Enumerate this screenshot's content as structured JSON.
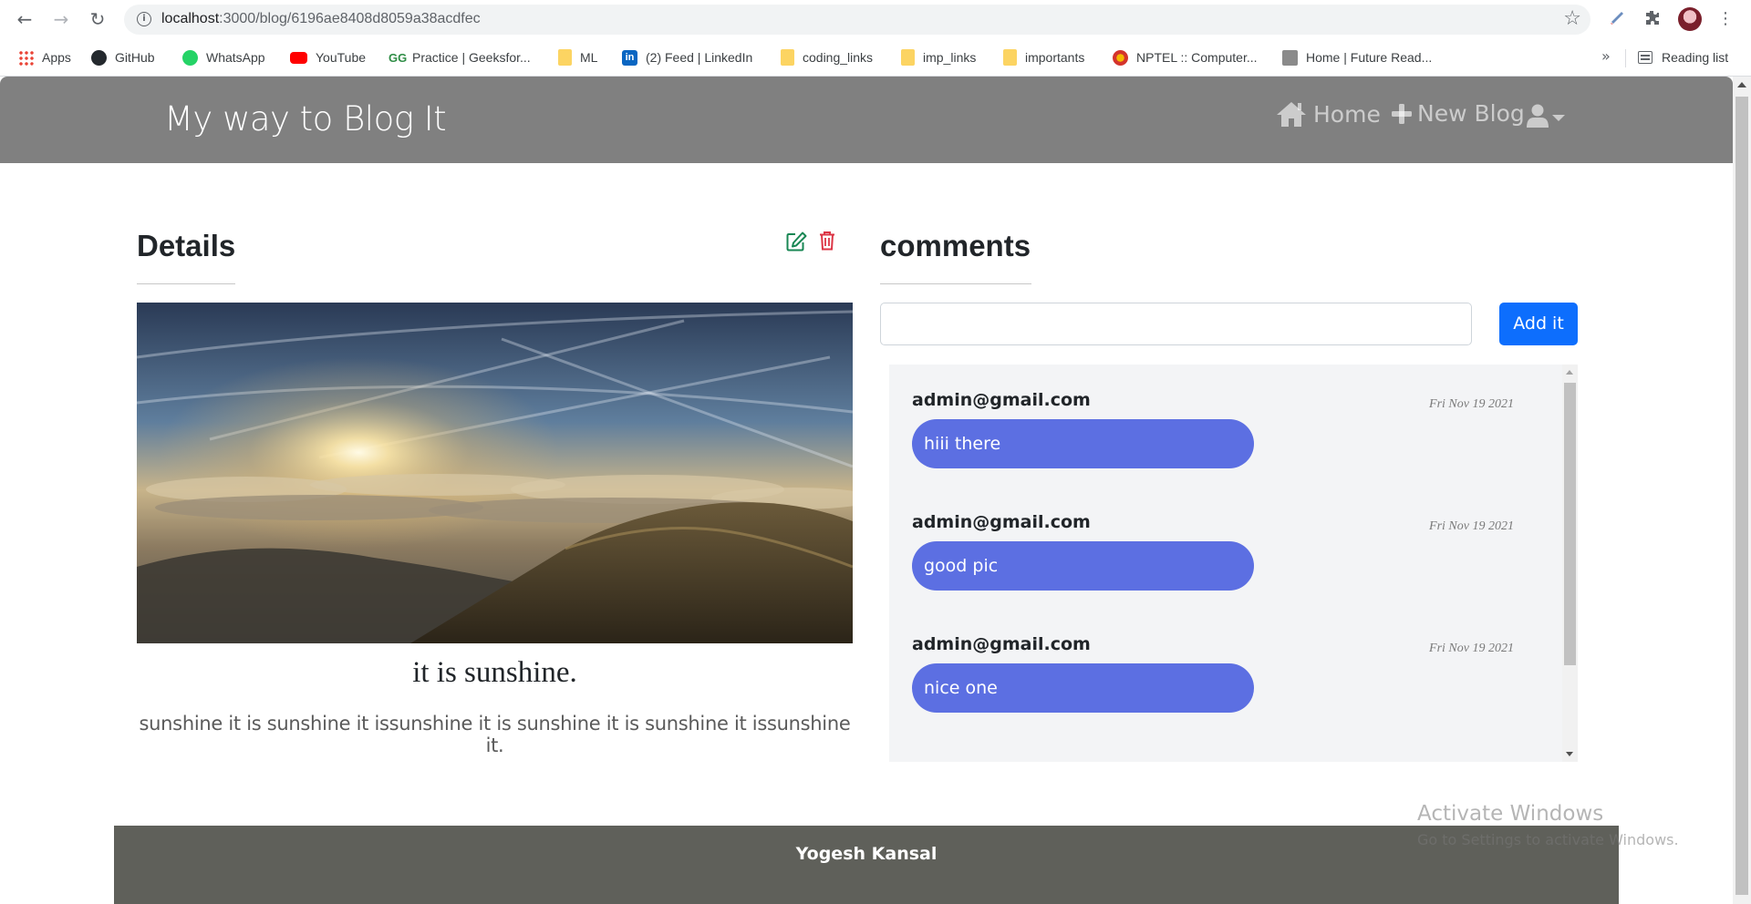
{
  "browser": {
    "url_host": "localhost",
    "url_path": ":3000/blog/6196ae8408d8059a38acdfec",
    "bookmarks": [
      {
        "label": "Apps",
        "icon": "apps-grid-icon"
      },
      {
        "label": "GitHub",
        "icon": "github-icon"
      },
      {
        "label": "WhatsApp",
        "icon": "whatsapp-icon"
      },
      {
        "label": "YouTube",
        "icon": "youtube-icon"
      },
      {
        "label": "Practice | Geeksfor...",
        "icon": "geeksforgeeks-icon"
      },
      {
        "label": "ML",
        "icon": "folder-icon"
      },
      {
        "label": "(2) Feed | LinkedIn",
        "icon": "linkedin-icon"
      },
      {
        "label": "coding_links",
        "icon": "folder-icon"
      },
      {
        "label": "imp_links",
        "icon": "folder-icon"
      },
      {
        "label": "importants",
        "icon": "folder-icon"
      },
      {
        "label": "NPTEL :: Computer...",
        "icon": "nptel-icon"
      },
      {
        "label": "Home | Future Read...",
        "icon": "future-read-icon"
      }
    ],
    "more": "»",
    "reading_list": "Reading list"
  },
  "navbar": {
    "brand": "My way to Blog It",
    "home": "Home",
    "new_blog": "New Blog"
  },
  "details": {
    "title": "Details",
    "blog_title": "it is sunshine.",
    "blog_body": "sunshine it is sunshine it issunshine it is sunshine it is sunshine it issunshine it."
  },
  "comments": {
    "title": "comments",
    "input_value": "",
    "add_button": "Add it",
    "items": [
      {
        "author": "admin@gmail.com",
        "date": "Fri Nov 19 2021",
        "text": "hiii there"
      },
      {
        "author": "admin@gmail.com",
        "date": "Fri Nov 19 2021",
        "text": "good pic"
      },
      {
        "author": "admin@gmail.com",
        "date": "Fri Nov 19 2021",
        "text": "nice one"
      }
    ]
  },
  "footer": {
    "name": "Yogesh Kansal"
  },
  "watermark": {
    "title": "Activate Windows",
    "subtitle": "Go to Settings to activate Windows."
  },
  "colors": {
    "navbar": "#808080",
    "primary_button": "#0d6efd",
    "comment_bubble": "#5c6fe2",
    "footer": "#5f605a",
    "edit_icon": "#198754",
    "delete_icon": "#dc3545"
  }
}
